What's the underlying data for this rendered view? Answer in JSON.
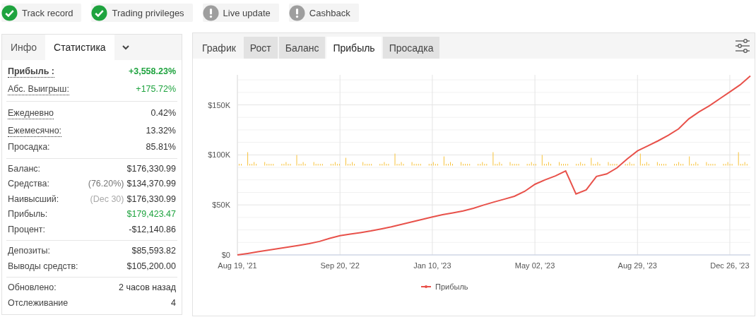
{
  "badges": [
    {
      "label": "Track record",
      "checked": true
    },
    {
      "label": "Trading privileges",
      "checked": true
    },
    {
      "label": "Live update",
      "checked": false
    },
    {
      "label": "Cashback",
      "checked": false
    }
  ],
  "stats_panel": {
    "tabs": [
      {
        "label": "Инфо",
        "selected": false
      },
      {
        "label": "Статистика",
        "selected": true
      }
    ],
    "groups": [
      {
        "rows": [
          {
            "label": "Прибыль :",
            "value": "+3,558.23%",
            "positive": true,
            "bold": true,
            "dotted": true
          },
          {
            "label": "Абс. Выигрыш:",
            "value": "+175.72%",
            "positive": true,
            "bold": false,
            "dotted": true
          }
        ]
      },
      {
        "rows": [
          {
            "label": "Ежедневно",
            "value": "0.42%",
            "positive": false,
            "bold": false,
            "dotted": true
          },
          {
            "label": "Ежемесячно:",
            "value": "13.32%",
            "positive": false,
            "bold": false,
            "dotted": true
          },
          {
            "label": "Просадка:",
            "value": "85.81%",
            "positive": false,
            "bold": false,
            "dotted": false
          }
        ]
      },
      {
        "rows": [
          {
            "label": "Баланс:",
            "value": "$176,330.99",
            "positive": false,
            "bold": false,
            "dotted": false
          },
          {
            "label": "Средства:",
            "note": "(76.20%)",
            "value": "$134,370.99",
            "positive": false,
            "bold": false,
            "dotted": false
          },
          {
            "label": "Наивысший:",
            "note": "(Dec 30)",
            "value": "$176,330.99",
            "positive": false,
            "bold": false,
            "dotted": false
          },
          {
            "label": "Прибыль:",
            "value": "$179,423.47",
            "positive": true,
            "bold": false,
            "dotted": false
          },
          {
            "label": "Процент:",
            "value": "-$12,140.86",
            "positive": false,
            "bold": false,
            "dotted": false
          }
        ]
      },
      {
        "rows": [
          {
            "label": "Депозиты:",
            "value": "$85,593.82",
            "positive": false,
            "bold": false,
            "dotted": false
          },
          {
            "label": "Выводы средств:",
            "value": "$105,200.00",
            "positive": false,
            "bold": false,
            "dotted": false
          }
        ]
      },
      {
        "rows": [
          {
            "label": "Обновлено:",
            "value": "2 часов назад",
            "positive": false,
            "bold": false,
            "dotted": false
          },
          {
            "label": "Отслеживание",
            "value": "4",
            "positive": false,
            "bold": false,
            "dotted": false
          }
        ]
      }
    ]
  },
  "chart_panel": {
    "tabs": [
      {
        "label": "График",
        "selected": false
      },
      {
        "label": "Рост",
        "selected": false
      },
      {
        "label": "Баланс",
        "selected": false
      },
      {
        "label": "Прибыль",
        "selected": true
      },
      {
        "label": "Просадка",
        "selected": false
      }
    ],
    "chart_data": {
      "type": "line",
      "categories": [
        "Aug 19, '21",
        null,
        null,
        null,
        null,
        null,
        null,
        null,
        null,
        null,
        "Sep 20, '22",
        null,
        null,
        null,
        null,
        null,
        null,
        null,
        null,
        "Jan 10, '23",
        null,
        null,
        null,
        null,
        null,
        null,
        null,
        null,
        null,
        "May 02, '23",
        null,
        null,
        null,
        null,
        null,
        null,
        null,
        null,
        null,
        "Aug 29, '23",
        null,
        null,
        null,
        null,
        null,
        null,
        null,
        null,
        "Dec 26, '23",
        null,
        null
      ],
      "series": [
        {
          "name": "Прибыль",
          "color": "#e8514a",
          "values": [
            0,
            1500,
            3200,
            4800,
            6400,
            8000,
            9600,
            11200,
            13500,
            16600,
            19300,
            20800,
            22300,
            24000,
            26000,
            28000,
            30500,
            33000,
            35500,
            38000,
            40200,
            42100,
            44000,
            46600,
            49800,
            52900,
            55700,
            58600,
            63500,
            70600,
            75100,
            79000,
            84000,
            61000,
            65000,
            78500,
            81000,
            87000,
            96000,
            104000,
            109000,
            114000,
            119500,
            126000,
            136000,
            143000,
            149000,
            156000,
            163000,
            170000,
            179000
          ]
        }
      ],
      "ylim": [
        0,
        180000
      ],
      "grid": true,
      "yticks": [
        {
          "value": 0,
          "label": "$0"
        },
        {
          "value": 50000,
          "label": "$50K"
        },
        {
          "value": 100000,
          "label": "$100K"
        },
        {
          "value": 150000,
          "label": "$150K"
        }
      ]
    }
  }
}
